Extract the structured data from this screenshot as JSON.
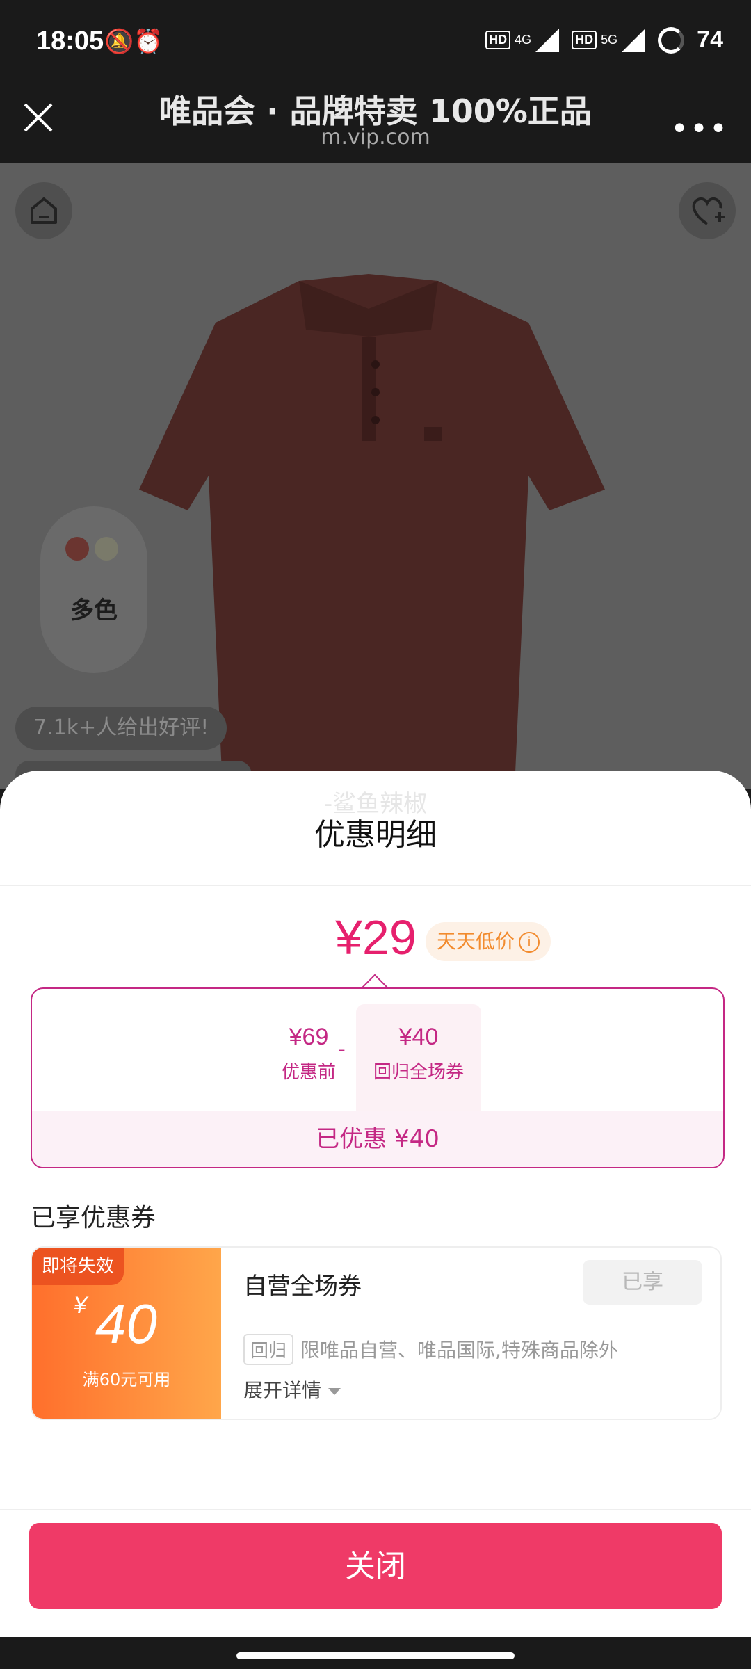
{
  "status_bar": {
    "time": "18:05",
    "left_icons": "🔕⏰",
    "network1": "4G",
    "network2": "5G",
    "hd": "HD",
    "battery": "74"
  },
  "top_bar": {
    "title": "唯品会 · 品牌特卖 100%正品",
    "subtitle": "m.vip.com",
    "more": "•••"
  },
  "product": {
    "colors_label": "多色",
    "swatch_colors": [
      "#6b3530",
      "#7a7a6a"
    ],
    "review_text": "7.1k+人给出好评!"
  },
  "sheet": {
    "ghost_text": "-鲨鱼辣椒",
    "title": "优惠明细",
    "price": "¥29",
    "price_tag": "天天低价",
    "price_tag_icon": "i",
    "before_value": "¥69",
    "before_label": "优惠前",
    "minus": "-",
    "coupon_value": "¥40",
    "coupon_label": "回归全场券",
    "saved_text": "已优惠 ¥40",
    "section_title": "已享优惠券",
    "coupon": {
      "expiring": "即将失效",
      "currency": "¥",
      "amount": "40",
      "min_spend": "满60元可用",
      "name": "自营全场券",
      "status_button": "已享",
      "return_tag": "回归",
      "description": "限唯品自营、唯品国际,特殊商品除外",
      "expand": "展开详情"
    },
    "close_button": "关闭"
  },
  "colors": {
    "accent": "#e6206d",
    "button": "#ef3a67",
    "orange": "#f28b2e"
  }
}
